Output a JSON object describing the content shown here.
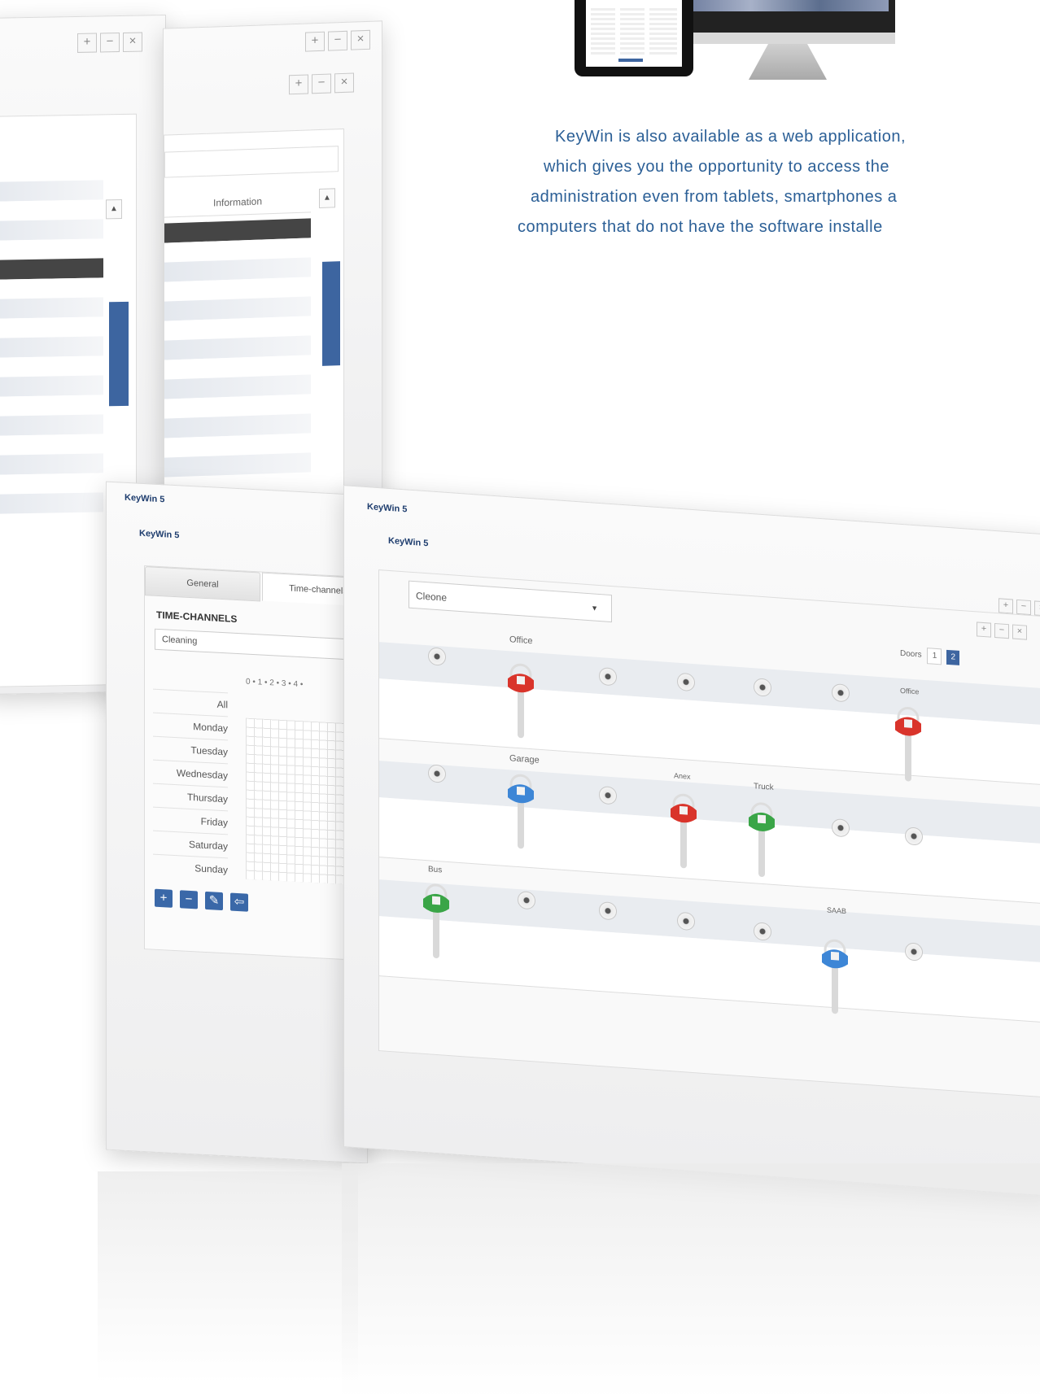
{
  "marketing": {
    "line1": "KeyWin is also available as a web application,",
    "line2": "which gives you the opportunity to access the",
    "line3": "administration even from tablets, smartphones a",
    "line4": "computers that do not have the software installe"
  },
  "win_controls": {
    "plus": "+",
    "minus": "−",
    "close": "×"
  },
  "back_window": {
    "column_header": "Information",
    "scroll_up": "▲"
  },
  "schedule_window": {
    "app_title": "KeyWin 5",
    "app_subtitle": "KeyWin 5",
    "tabs": [
      "General",
      "Time-channels"
    ],
    "section_title": "TIME-CHANNELS",
    "selected_channel": "Cleaning",
    "hour_header": "0 • 1 • 2 • 3 • 4 •",
    "days": [
      "All",
      "Monday",
      "Tuesday",
      "Wednesday",
      "Thursday",
      "Friday",
      "Saturday",
      "Sunday"
    ],
    "toolbar": {
      "add": "+",
      "remove": "−",
      "edit": "✎",
      "back": "⇦"
    }
  },
  "keys_window": {
    "app_title": "KeyWin 5",
    "app_subtitle": "KeyWin 5",
    "dropdown_value": "Cleone",
    "dropdown_arrow": "▼",
    "doors_label": "Doors",
    "door_page": "1",
    "door_page_2": "2",
    "rows": [
      {
        "labels": [
          "Office",
          "",
          "",
          "",
          "",
          "Office"
        ]
      },
      {
        "labels": [
          "Garage",
          "",
          "Anex",
          "Truck",
          "",
          ""
        ]
      },
      {
        "labels": [
          "Bus",
          "",
          "",
          "",
          "SAAB",
          ""
        ]
      }
    ]
  },
  "colors": {
    "accent": "#3d65a0",
    "text_blue": "#2b5f96",
    "key_red": "#d9342b",
    "key_blue": "#3d86d6",
    "key_green": "#3aa547"
  }
}
